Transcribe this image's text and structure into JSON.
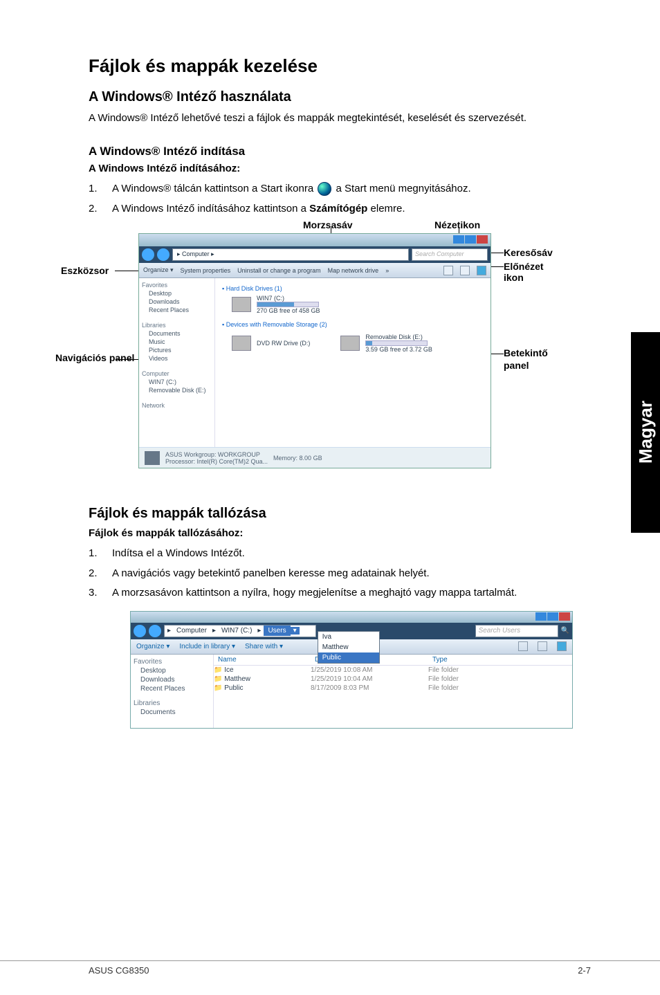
{
  "main_title": "Fájlok és mappák kezelése",
  "section1": {
    "title": "A Windows® Intéző használata",
    "intro": "A Windows® Intéző lehetővé teszi a fájlok és mappák megtekintését, keselését és szervezését."
  },
  "section2": {
    "title": "A Windows® Intéző indítása",
    "label": "A Windows Intéző indításához:",
    "step1_a": "A Windows® tálcán kattintson a Start ikonra",
    "step1_b": "a Start menü megnyitásához.",
    "step2_a": "A Windows Intéző indításához kattintson a ",
    "step2_bold": "Számítógép",
    "step2_b": " elemre."
  },
  "callouts": {
    "morzsasav": "Morzsasáv",
    "nezetikon": "Nézetikon",
    "eszkozsor": "Eszközsor",
    "navigacios": "Navigációs panel",
    "keresosav": "Keresősáv",
    "elonezet": "Előnézet ikon",
    "betekinto": "Betekintő panel"
  },
  "explorer1": {
    "breadcrumb_arrow": "▸",
    "breadcrumb": "Computer",
    "search_placeholder": "Search Computer",
    "toolbar": {
      "organize": "Organize ▾",
      "sysprops": "System properties",
      "uninstall": "Uninstall or change a program",
      "mapdrive": "Map network drive",
      "more": "»"
    },
    "nav": {
      "favorites": "Favorites",
      "desktop": "Desktop",
      "downloads": "Downloads",
      "recent": "Recent Places",
      "libraries": "Libraries",
      "documents": "Documents",
      "music": "Music",
      "pictures": "Pictures",
      "videos": "Videos",
      "computer": "Computer",
      "localc": "WIN7 (C:)",
      "removable": "Removable Disk (E:)",
      "network": "Network"
    },
    "content": {
      "hdd_header": "Hard Disk Drives (1)",
      "hdd_name": "WIN7 (C:)",
      "hdd_info": "270 GB free of 458 GB",
      "rem_header": "Devices with Removable Storage (2)",
      "dvd": "DVD RW Drive (D:)",
      "remdisk": "Removable Disk (E:)",
      "remdisk_info": "3.59 GB free of 3.72 GB"
    },
    "status": {
      "workgroup": "ASUS  Workgroup: WORKGROUP",
      "memory": "Memory: 8.00 GB",
      "processor": "Processor: Intel(R) Core(TM)2 Qua..."
    }
  },
  "section3": {
    "title": "Fájlok és mappák tallózása",
    "label": "Fájlok és mappák tallózásához:",
    "step1": "Indítsa el a Windows Intézőt.",
    "step2": "A navigációs vagy betekintő panelben keresse meg adatainak helyét.",
    "step3": "A morzsasávon kattintson a nyílra, hogy megjelenítse a meghajtó vagy mappa tartalmát."
  },
  "explorer2": {
    "bc1": "Computer",
    "bc2": "WIN7 (C:)",
    "bc3": "Users",
    "dd1": "Iva",
    "dd2": "Matthew",
    "dd3": "Public",
    "search_placeholder": "Search Users",
    "toolbar": {
      "organize": "Organize ▾",
      "include": "Include in library ▾",
      "share": "Share with ▾"
    },
    "cols": {
      "name": "Name",
      "date": "Date modified",
      "type": "Type"
    },
    "rows": [
      {
        "name": "Ice",
        "date": "1/25/2019 10:08 AM",
        "type": "File folder"
      },
      {
        "name": "Matthew",
        "date": "1/25/2019 10:04 AM",
        "type": "File folder"
      },
      {
        "name": "Public",
        "date": "8/17/2009 8:03 PM",
        "type": "File folder"
      }
    ],
    "nav": {
      "favorites": "Favorites",
      "desktop": "Desktop",
      "downloads": "Downloads",
      "recent": "Recent Places",
      "libraries": "Libraries",
      "documents": "Documents"
    }
  },
  "sidebar": "Magyar",
  "footer": {
    "left": "ASUS CG8350",
    "right": "2-7"
  }
}
